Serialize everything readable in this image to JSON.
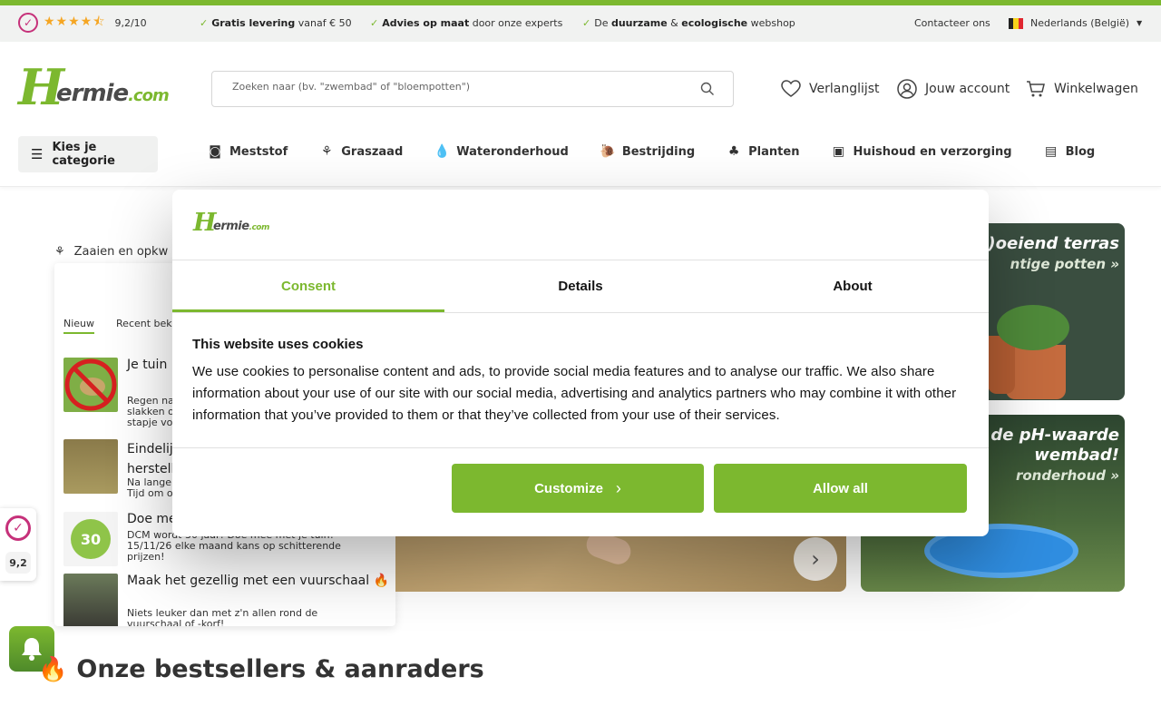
{
  "topbar": {
    "rating_value": "9,2/10",
    "usps": [
      {
        "bold": "Gratis levering",
        "rest": " vanaf € 50"
      },
      {
        "bold": "Advies op maat",
        "rest": " door onze experts"
      },
      {
        "pre": "De ",
        "bold": "duurzame",
        "mid": " & ",
        "bold2": "ecologische",
        "rest": " webshop"
      }
    ],
    "contact": "Contacteer ons",
    "language": "Nederlands (België)"
  },
  "header": {
    "logo_letter": "H",
    "logo_name": "ermie",
    "logo_domain": ".com",
    "search_placeholder": "Zoeken naar (bv. \"zwembad\" of \"bloempotten\")",
    "wishlist": "Verlanglijst",
    "account": "Jouw account",
    "cart": "Winkelwagen",
    "category_button": "Kies je categorie",
    "nav": [
      "Meststof",
      "Graszaad",
      "Wateronderhoud",
      "Bestrijding",
      "Planten",
      "Huishoud en verzorging",
      "Blog"
    ]
  },
  "background": {
    "breadcrumb": "Zaaien en opkw",
    "news_tabs": [
      "Nieuw",
      "Recent bek"
    ],
    "news": [
      {
        "title": "Je tuin l",
        "desc": "Regen na\nslakken o\nstapje vo"
      },
      {
        "title": "Eindelij\nherstell",
        "desc": "Na lange\nTijd om o"
      },
      {
        "title": "Doe me",
        "desc": "DCM wordt 30 jaar! Doe mee met je tuin!\n15/11/26 elke maand kans op schitterende\nprijzen!"
      },
      {
        "title": "Maak het gezellig met een vuurschaal 🔥",
        "desc": "Niets leuker dan met z'n allen rond de\nvuurschaal of -korf!"
      }
    ],
    "banner1_title": "b(l)oeiend terras",
    "banner1_sub": "ntige potten »",
    "banner2_title": "ck de pH-waarde\nwembad!",
    "banner2_sub": "ronderhoud »",
    "kiyoh_score": "9,2",
    "bestsellers": "Onze bestsellers & aanraders"
  },
  "cookie": {
    "logo_letter": "H",
    "logo_name": "ermie",
    "logo_domain": ".com",
    "tabs": [
      "Consent",
      "Details",
      "About"
    ],
    "heading": "This website uses cookies",
    "body": "We use cookies to personalise content and ads, to provide social media features and to analyse our traffic. We also share information about your use of our site with our social media, advertising and analytics partners who may combine it with other information that you’ve provided to them or that they’ve collected from your use of their services.",
    "customize": "Customize",
    "allow_all": "Allow all"
  },
  "colors": {
    "brand": "#7cb82f",
    "kiyoh": "#c6317a",
    "star": "#f5a623"
  }
}
